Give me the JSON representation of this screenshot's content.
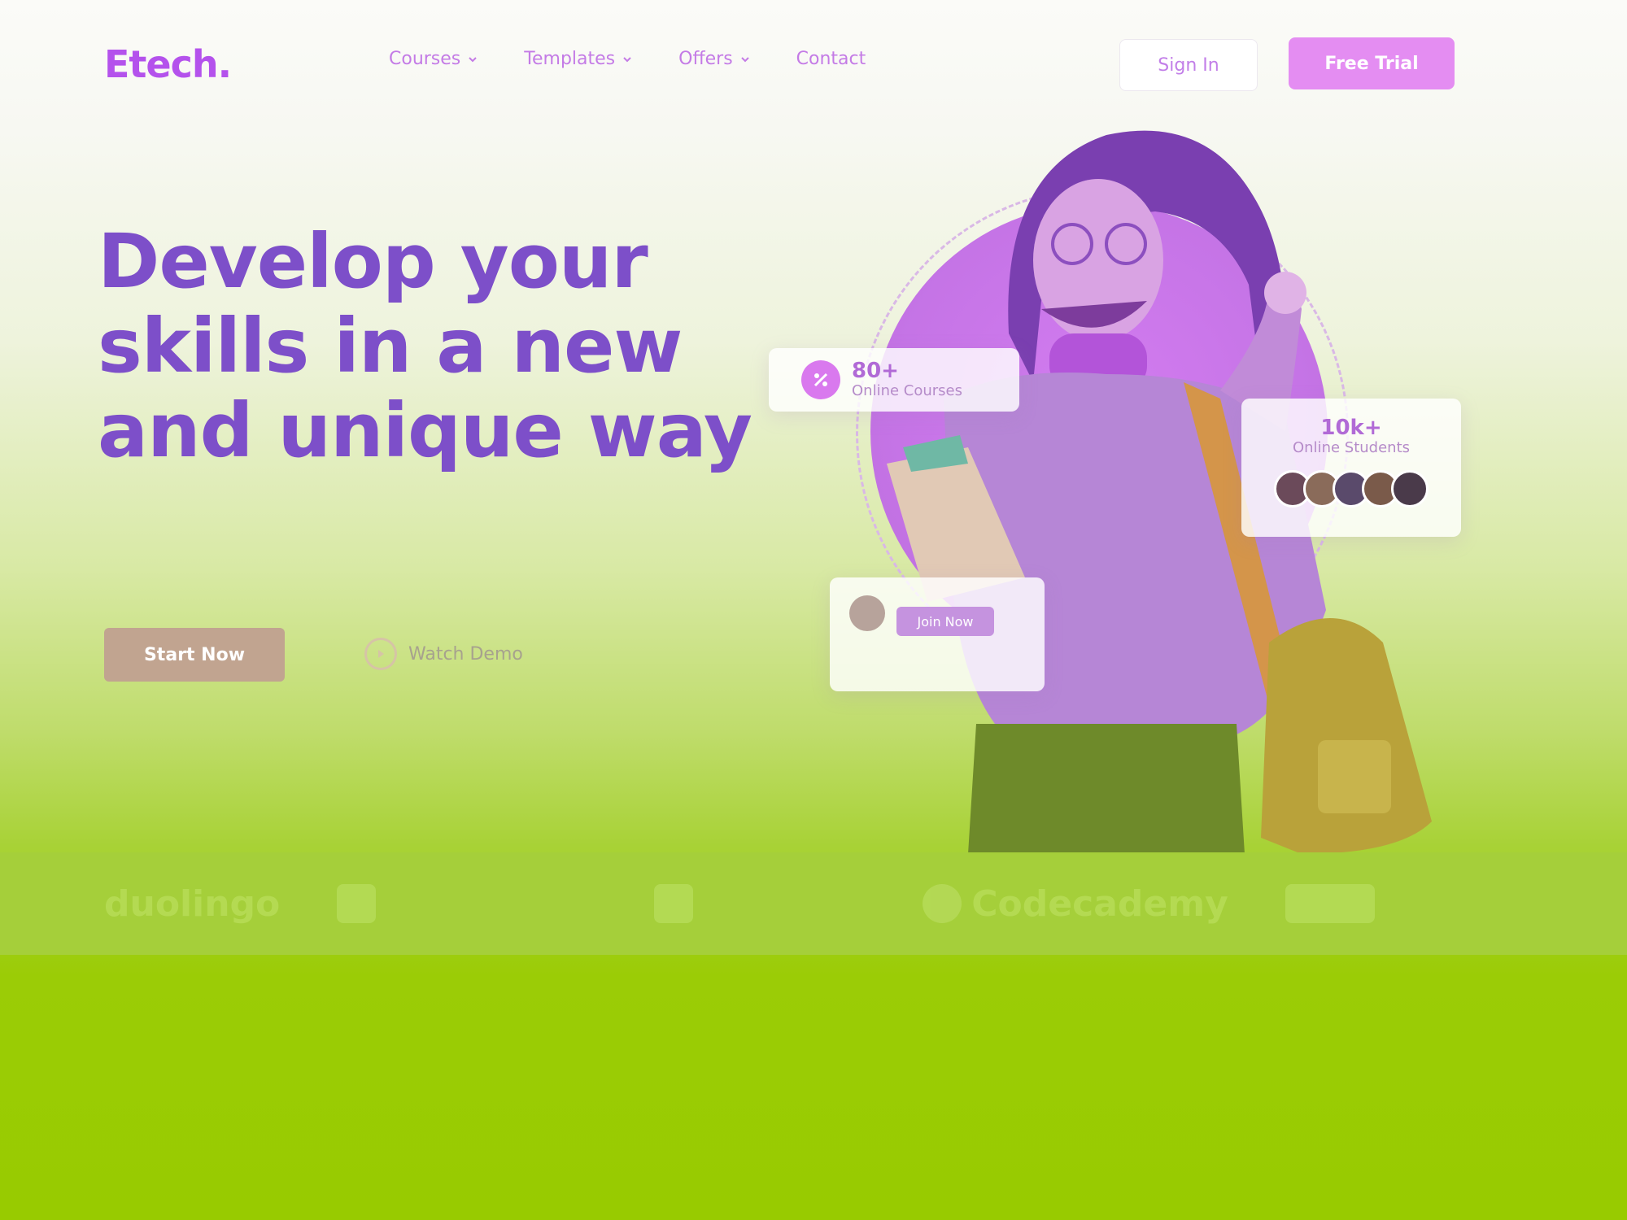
{
  "header": {
    "logo": "Etech.",
    "nav": [
      {
        "label": "Courses"
      },
      {
        "label": "Templates"
      },
      {
        "label": "Offers"
      },
      {
        "label": "Contact"
      }
    ],
    "signin_label": "Sign In",
    "free_trial_label": "Free Trial"
  },
  "hero": {
    "title_lines": [
      "Develop your",
      "skills in a new",
      "and unique way"
    ],
    "description": "",
    "start_label": "Start Now",
    "demo_label": "Watch Demo",
    "card_courses": {
      "value": "80+",
      "label": "Online Courses"
    },
    "card_students": {
      "value": "10k+",
      "label": "Online Students"
    },
    "card_class": {
      "title": "",
      "join_label": "Join Now"
    }
  },
  "partners": [
    {
      "name": "duolingo",
      "icon": "duolingo-logo"
    },
    {
      "name": "",
      "icon": "partner-logo-2"
    },
    {
      "name": "",
      "icon": "partner-logo-3"
    },
    {
      "name": "Codecademy",
      "icon": "codecademy-logo"
    },
    {
      "name": "",
      "icon": "partner-logo-5"
    }
  ],
  "colors": {
    "brand": "#b452ec",
    "accent_pink": "#e48df2",
    "title": "#7d4fc9",
    "strip": "#a5cf3a"
  }
}
